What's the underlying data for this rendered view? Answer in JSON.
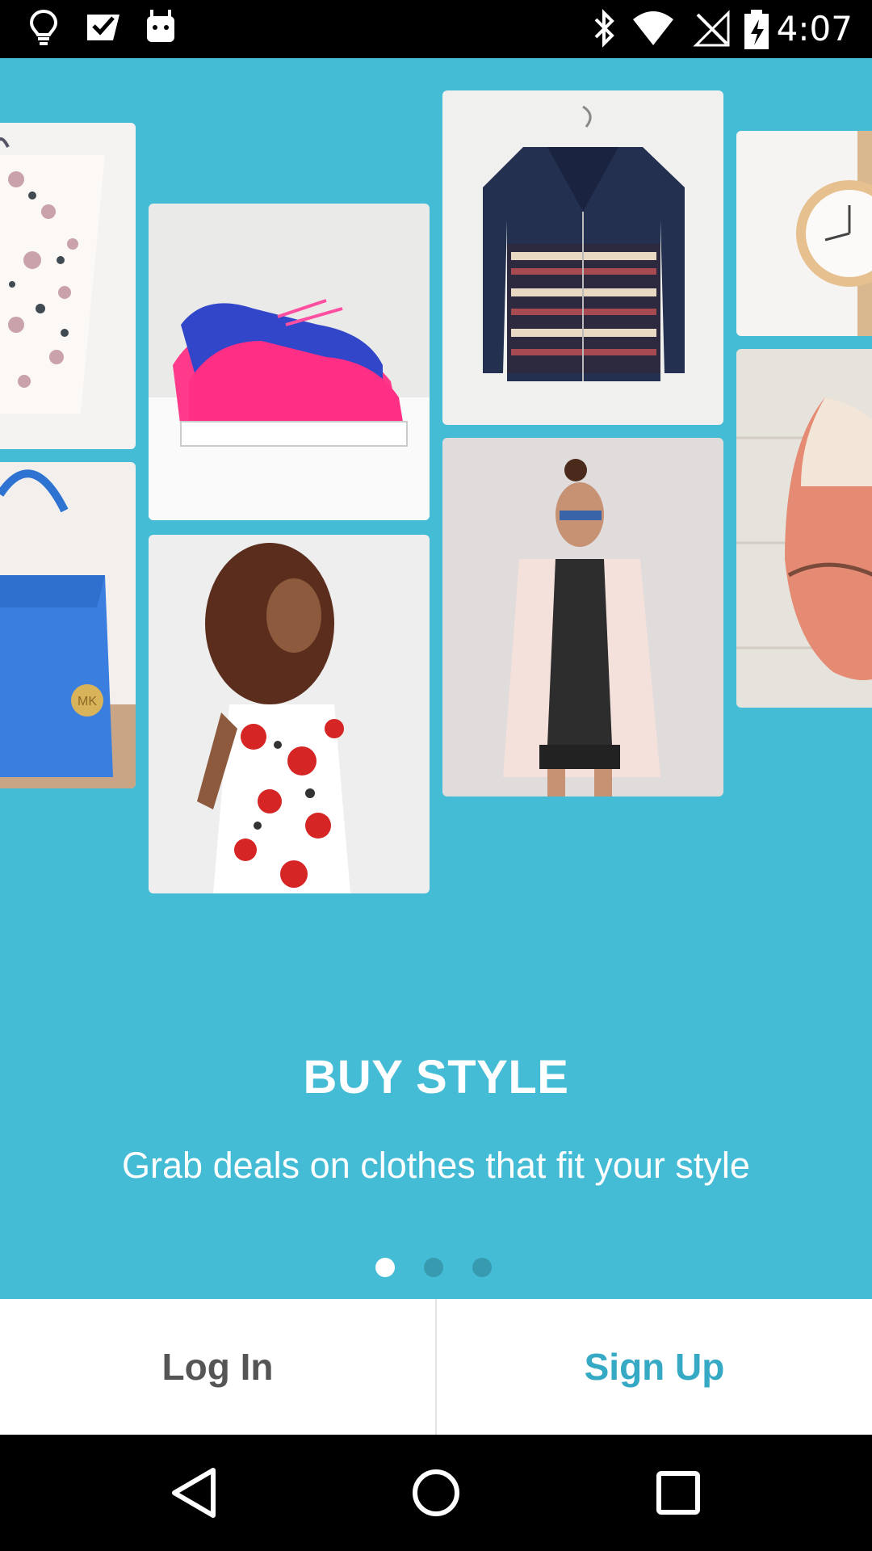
{
  "status_bar": {
    "time": "4:07",
    "left_icons": [
      "lightbulb-icon",
      "checkmark-badge-icon",
      "android-icon"
    ],
    "right_icons": [
      "bluetooth-icon",
      "wifi-icon",
      "no-signal-icon",
      "battery-charging-icon"
    ]
  },
  "onboarding": {
    "title": "BUY STYLE",
    "subtitle": "Grab deals on clothes that fit your style",
    "page_count": 3,
    "active_page": 1,
    "photos": [
      "floral-cardigan-photo",
      "blue-handbag-photo",
      "pink-sneakers-photo",
      "floral-dress-model-photo",
      "leather-jacket-photo",
      "blazer-model-photo",
      "gold-watch-photo",
      "pointed-flat-shoe-photo"
    ]
  },
  "actions": {
    "login_label": "Log In",
    "signup_label": "Sign Up"
  },
  "colors": {
    "brand_background": "#44bcd6",
    "signup_text": "#36a9c4",
    "login_text": "#555555"
  },
  "nav_bar": {
    "buttons": [
      "back-icon",
      "home-icon",
      "recents-icon"
    ]
  }
}
